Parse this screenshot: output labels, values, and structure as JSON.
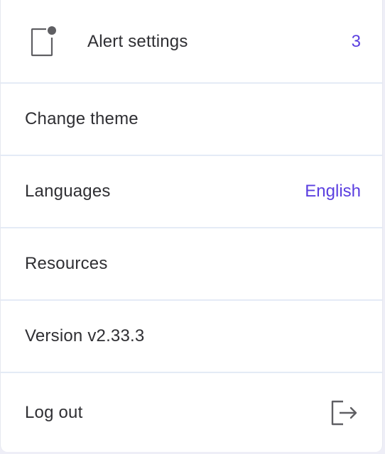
{
  "menu": {
    "alert_settings": {
      "label": "Alert settings",
      "count": "3",
      "icon": "notification-icon"
    },
    "change_theme": {
      "label": "Change theme"
    },
    "languages": {
      "label": "Languages",
      "value": "English"
    },
    "resources": {
      "label": "Resources"
    },
    "version": {
      "label": "Version v2.33.3"
    },
    "log_out": {
      "label": "Log out",
      "icon": "logout-icon"
    }
  },
  "colors": {
    "accent": "#5b3fe0",
    "text": "#2f2f33",
    "divider": "#e4ebf6",
    "icon": "#5f5f63"
  }
}
